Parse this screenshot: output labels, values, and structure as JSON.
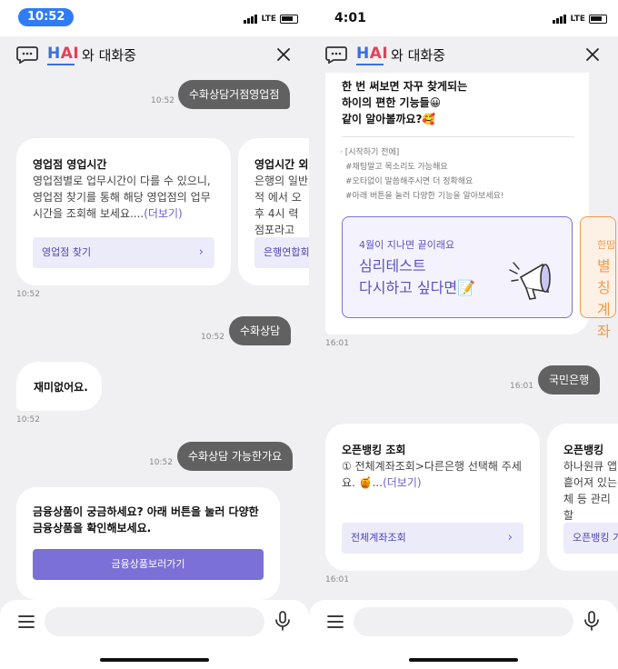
{
  "header": {
    "brand_h": "H",
    "brand_ai": "AI",
    "title": "와 대화중"
  },
  "composer": {
    "placeholder": ""
  },
  "screen1": {
    "status_time": "10:52",
    "user_msg_1": {
      "text": "수화상담거점영업점",
      "time": "10:52"
    },
    "card_a": {
      "title": "영업점 영업시간",
      "body": "영업점별로 업무시간이 다를 수 있으니, 영업점 찾기를 통해 해당 영업점의 업무시간을 조회해 보세요....",
      "more": "(더보기)",
      "button": "영업점 찾기"
    },
    "card_b": {
      "title": "영업시간 외",
      "body": "은행의 일반적 에서 오후 4시 력 점포라고",
      "button": "은행연합회"
    },
    "cards_time": "10:52",
    "user_msg_2": {
      "text": "수화상담",
      "time": "10:52"
    },
    "bot_msg": {
      "text": "재미없어요.",
      "time": "10:52"
    },
    "user_msg_3": {
      "text": "수화상담 가능한가요",
      "time": "10:52"
    },
    "bot_card": {
      "text": "금융상품이 궁금하세요? 아래 버튼을 눌러 다양한 금융상품을 확인해보세요.",
      "button": "금융상품보러가기"
    }
  },
  "screen2": {
    "status_time": "4:01",
    "intro": {
      "line1": "한 번 써보면 자꾸 찾게되는",
      "line2": "하이의 편한 기능들😀",
      "line3": "같이 알아볼까요?🥰",
      "tips": [
        "· [시작하기 전에]",
        "#채팅말고 목소리도 가능해요",
        "#오타없이 말씀해주시면 더 정확해요",
        "#아래 버튼을 눌러 다양한 기능을 알아보세요!"
      ],
      "promo_small": "4월이 지나면 끝이래요",
      "promo_big_1": "심리테스트",
      "promo_big_2": "다시하고 싶다면📝",
      "promo2_small": "한땀",
      "promo2_big_1": "별칭",
      "promo2_big_2": "계좌"
    },
    "intro_time": "16:01",
    "user_msg": {
      "text": "국민은행",
      "time": "16:01"
    },
    "card_a": {
      "title": "오픈뱅킹 조회",
      "body": "① 전체계좌조회>다른은행 선택해 주세요. 🍯...",
      "more": "(더보기)",
      "button": "전체계좌조회"
    },
    "card_b": {
      "title": "오픈뱅킹",
      "body": "하나원큐 앱 흩어져 있는 체 등 관리 할",
      "button": "오픈뱅킹 가"
    },
    "cards_time": "16:01"
  },
  "colors": {
    "accent": "#7b70d6",
    "user_bubble": "#616161",
    "status_pill": "#2f7cf6",
    "promo_orange": "#f2994a"
  },
  "icons": [
    "chat-bubble-icon",
    "close-icon",
    "menu-icon",
    "microphone-icon",
    "chevron-right-icon",
    "megaphone-icon"
  ]
}
